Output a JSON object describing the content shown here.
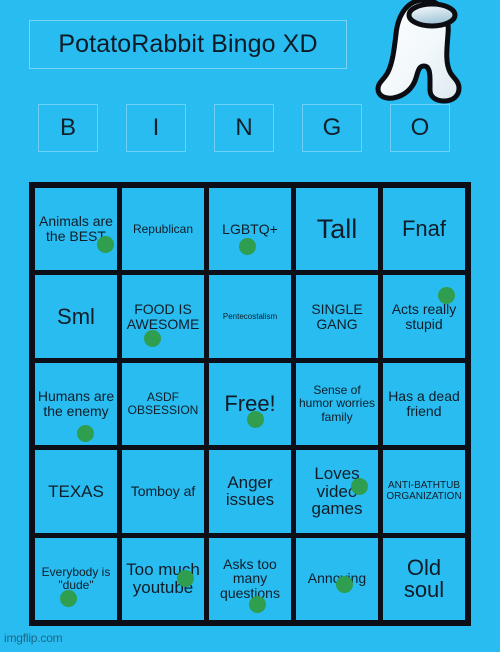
{
  "meta": {
    "background_color": "#29bcf0",
    "grid_border_color": "#0c0f18",
    "cell_color": "#29bcf0",
    "text_color": "#101d28",
    "marker_color": "#2f9e4f",
    "watermark": "imgflip.com"
  },
  "header": {
    "title": "PotatoRabbit Bingo XD",
    "letters": [
      "B",
      "I",
      "N",
      "G",
      "O"
    ],
    "mascot": "among-us-crewmate"
  },
  "card": {
    "columns": [
      "B",
      "I",
      "N",
      "G",
      "O"
    ],
    "rows": [
      [
        {
          "text": "Animals are the BEST",
          "marked": true,
          "size": "fs-m",
          "mx": 62,
          "my": 48
        },
        {
          "text": "Republican",
          "marked": false,
          "size": "fs-s",
          "mx": 0,
          "my": 0
        },
        {
          "text": "LGBTQ+",
          "marked": true,
          "size": "fs-m",
          "mx": 30,
          "my": 50
        },
        {
          "text": "Tall",
          "marked": false,
          "size": "fs-xxl",
          "mx": 0,
          "my": 0
        },
        {
          "text": "Fnaf",
          "marked": false,
          "size": "fs-xl",
          "mx": 0,
          "my": 0
        }
      ],
      [
        {
          "text": "Sml",
          "marked": false,
          "size": "fs-xl",
          "mx": 0,
          "my": 0
        },
        {
          "text": "FOOD IS AWESOME",
          "marked": true,
          "size": "fs-m",
          "mx": 22,
          "my": 55
        },
        {
          "text": "Pentecostalism",
          "marked": false,
          "size": "fs-xxs",
          "mx": 0,
          "my": 0
        },
        {
          "text": "SINGLE GANG",
          "marked": false,
          "size": "fs-m",
          "mx": 0,
          "my": 0
        },
        {
          "text": "Acts really stupid",
          "marked": true,
          "size": "fs-m",
          "mx": 55,
          "my": 12
        }
      ],
      [
        {
          "text": "Humans are the enemy",
          "marked": true,
          "size": "fs-m",
          "mx": 42,
          "my": 62
        },
        {
          "text": "ASDF OBSESSION",
          "marked": false,
          "size": "fs-s",
          "mx": 0,
          "my": 0
        },
        {
          "text": "Free!",
          "marked": true,
          "size": "fs-xl",
          "mx": 38,
          "my": 48
        },
        {
          "text": "Sense of humor worries family",
          "marked": false,
          "size": "fs-s",
          "mx": 0,
          "my": 0
        },
        {
          "text": "Has a dead friend",
          "marked": false,
          "size": "fs-m",
          "mx": 0,
          "my": 0
        }
      ],
      [
        {
          "text": "TEXAS",
          "marked": false,
          "size": "fs-l",
          "mx": 0,
          "my": 0
        },
        {
          "text": "Tomboy af",
          "marked": false,
          "size": "fs-m",
          "mx": 0,
          "my": 0
        },
        {
          "text": "Anger issues",
          "marked": false,
          "size": "fs-l",
          "mx": 0,
          "my": 0
        },
        {
          "text": "Loves video games",
          "marked": true,
          "size": "fs-l",
          "mx": 55,
          "my": 28
        },
        {
          "text": "ANTI-BATHTUB ORGANIZATION",
          "marked": false,
          "size": "fs-xs",
          "mx": 0,
          "my": 0
        }
      ],
      [
        {
          "text": "Everybody is \"dude\"",
          "marked": true,
          "size": "fs-s",
          "mx": 25,
          "my": 52
        },
        {
          "text": "Too much youtube",
          "marked": true,
          "size": "fs-l",
          "mx": 55,
          "my": 32
        },
        {
          "text": "Asks too many questions",
          "marked": true,
          "size": "fs-m",
          "mx": 40,
          "my": 58
        },
        {
          "text": "Annoying",
          "marked": true,
          "size": "fs-m",
          "mx": 40,
          "my": 38
        },
        {
          "text": "Old soul",
          "marked": false,
          "size": "fs-xl",
          "mx": 0,
          "my": 0
        }
      ]
    ]
  }
}
